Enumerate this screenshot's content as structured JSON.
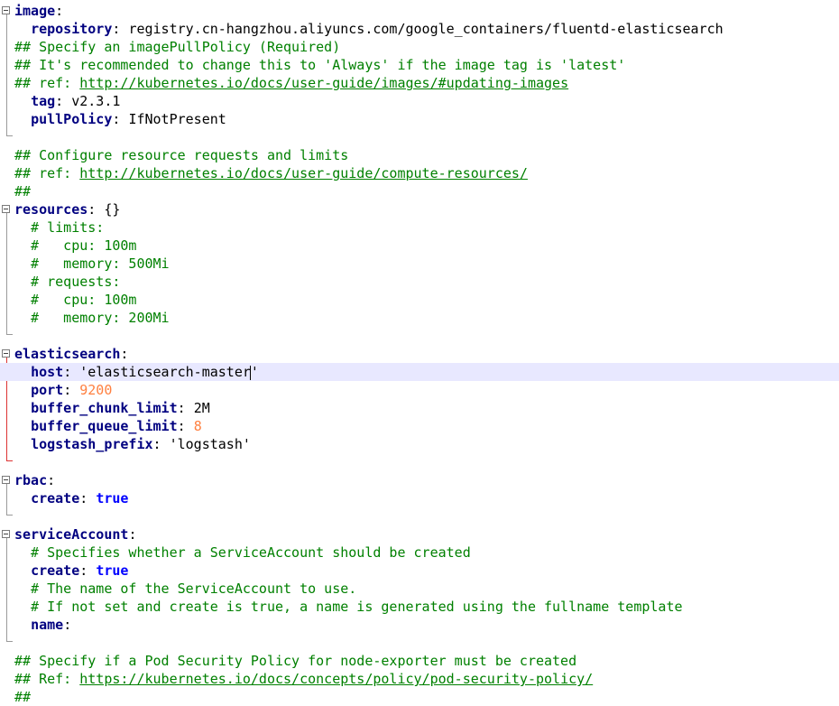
{
  "lines": [
    {
      "indent": 0,
      "key": "image",
      "fold": true
    },
    {
      "indent": 2,
      "key": "repository",
      "value": "registry.cn-hangzhou.aliyuncs.com/google_containers/fluentd-elasticsearch"
    },
    {
      "comment": "## Specify an imagePullPolicy (Required)"
    },
    {
      "comment": "## It's recommended to change this to 'Always' if the image tag is 'latest'"
    },
    {
      "comment_prefix": "## ref: ",
      "url": "http://kubernetes.io/docs/user-guide/images/#updating-images"
    },
    {
      "indent": 2,
      "key": "tag",
      "value": "v2.3.1"
    },
    {
      "indent": 2,
      "key": "pullPolicy",
      "value": "IfNotPresent"
    },
    {
      "blank": true
    },
    {
      "comment": "## Configure resource requests and limits"
    },
    {
      "comment_prefix": "## ref: ",
      "url": "http://kubernetes.io/docs/user-guide/compute-resources/"
    },
    {
      "comment": "##"
    },
    {
      "indent": 0,
      "key": "resources",
      "value": "{}",
      "fold": true
    },
    {
      "comment": "  # limits:"
    },
    {
      "comment": "  #   cpu: 100m"
    },
    {
      "comment": "  #   memory: 500Mi"
    },
    {
      "comment": "  # requests:"
    },
    {
      "comment": "  #   cpu: 100m"
    },
    {
      "comment": "  #   memory: 200Mi"
    },
    {
      "blank": true
    },
    {
      "indent": 0,
      "key": "elasticsearch",
      "fold": true
    },
    {
      "indent": 2,
      "key": "host",
      "value": "'elasticsearch-master'",
      "current": true
    },
    {
      "indent": 2,
      "key": "port",
      "number": "9200"
    },
    {
      "indent": 2,
      "key": "buffer_chunk_limit",
      "value": "2M"
    },
    {
      "indent": 2,
      "key": "buffer_queue_limit",
      "number": "8"
    },
    {
      "indent": 2,
      "key": "logstash_prefix",
      "value": "'logstash'"
    },
    {
      "blank": true
    },
    {
      "indent": 0,
      "key": "rbac",
      "fold": true
    },
    {
      "indent": 2,
      "key": "create",
      "keyword": "true"
    },
    {
      "blank": true
    },
    {
      "indent": 0,
      "key": "serviceAccount",
      "fold": true
    },
    {
      "comment": "  # Specifies whether a ServiceAccount should be created"
    },
    {
      "indent": 2,
      "key": "create",
      "keyword": "true"
    },
    {
      "comment": "  # The name of the ServiceAccount to use."
    },
    {
      "comment": "  # If not set and create is true, a name is generated using the fullname template"
    },
    {
      "indent": 2,
      "key": "name",
      "value": ""
    },
    {
      "blank": true
    },
    {
      "comment": "## Specify if a Pod Security Policy for node-exporter must be created"
    },
    {
      "comment_prefix": "## Ref: ",
      "url": "https://kubernetes.io/docs/concepts/policy/pod-security-policy/"
    },
    {
      "comment": "##"
    }
  ],
  "colors": {
    "key": "#000080",
    "comment": "#008000",
    "number": "#ff8040",
    "keyword": "#0000ff",
    "current_line": "#e8e8ff",
    "active_fold_guide": "#dd3333"
  }
}
